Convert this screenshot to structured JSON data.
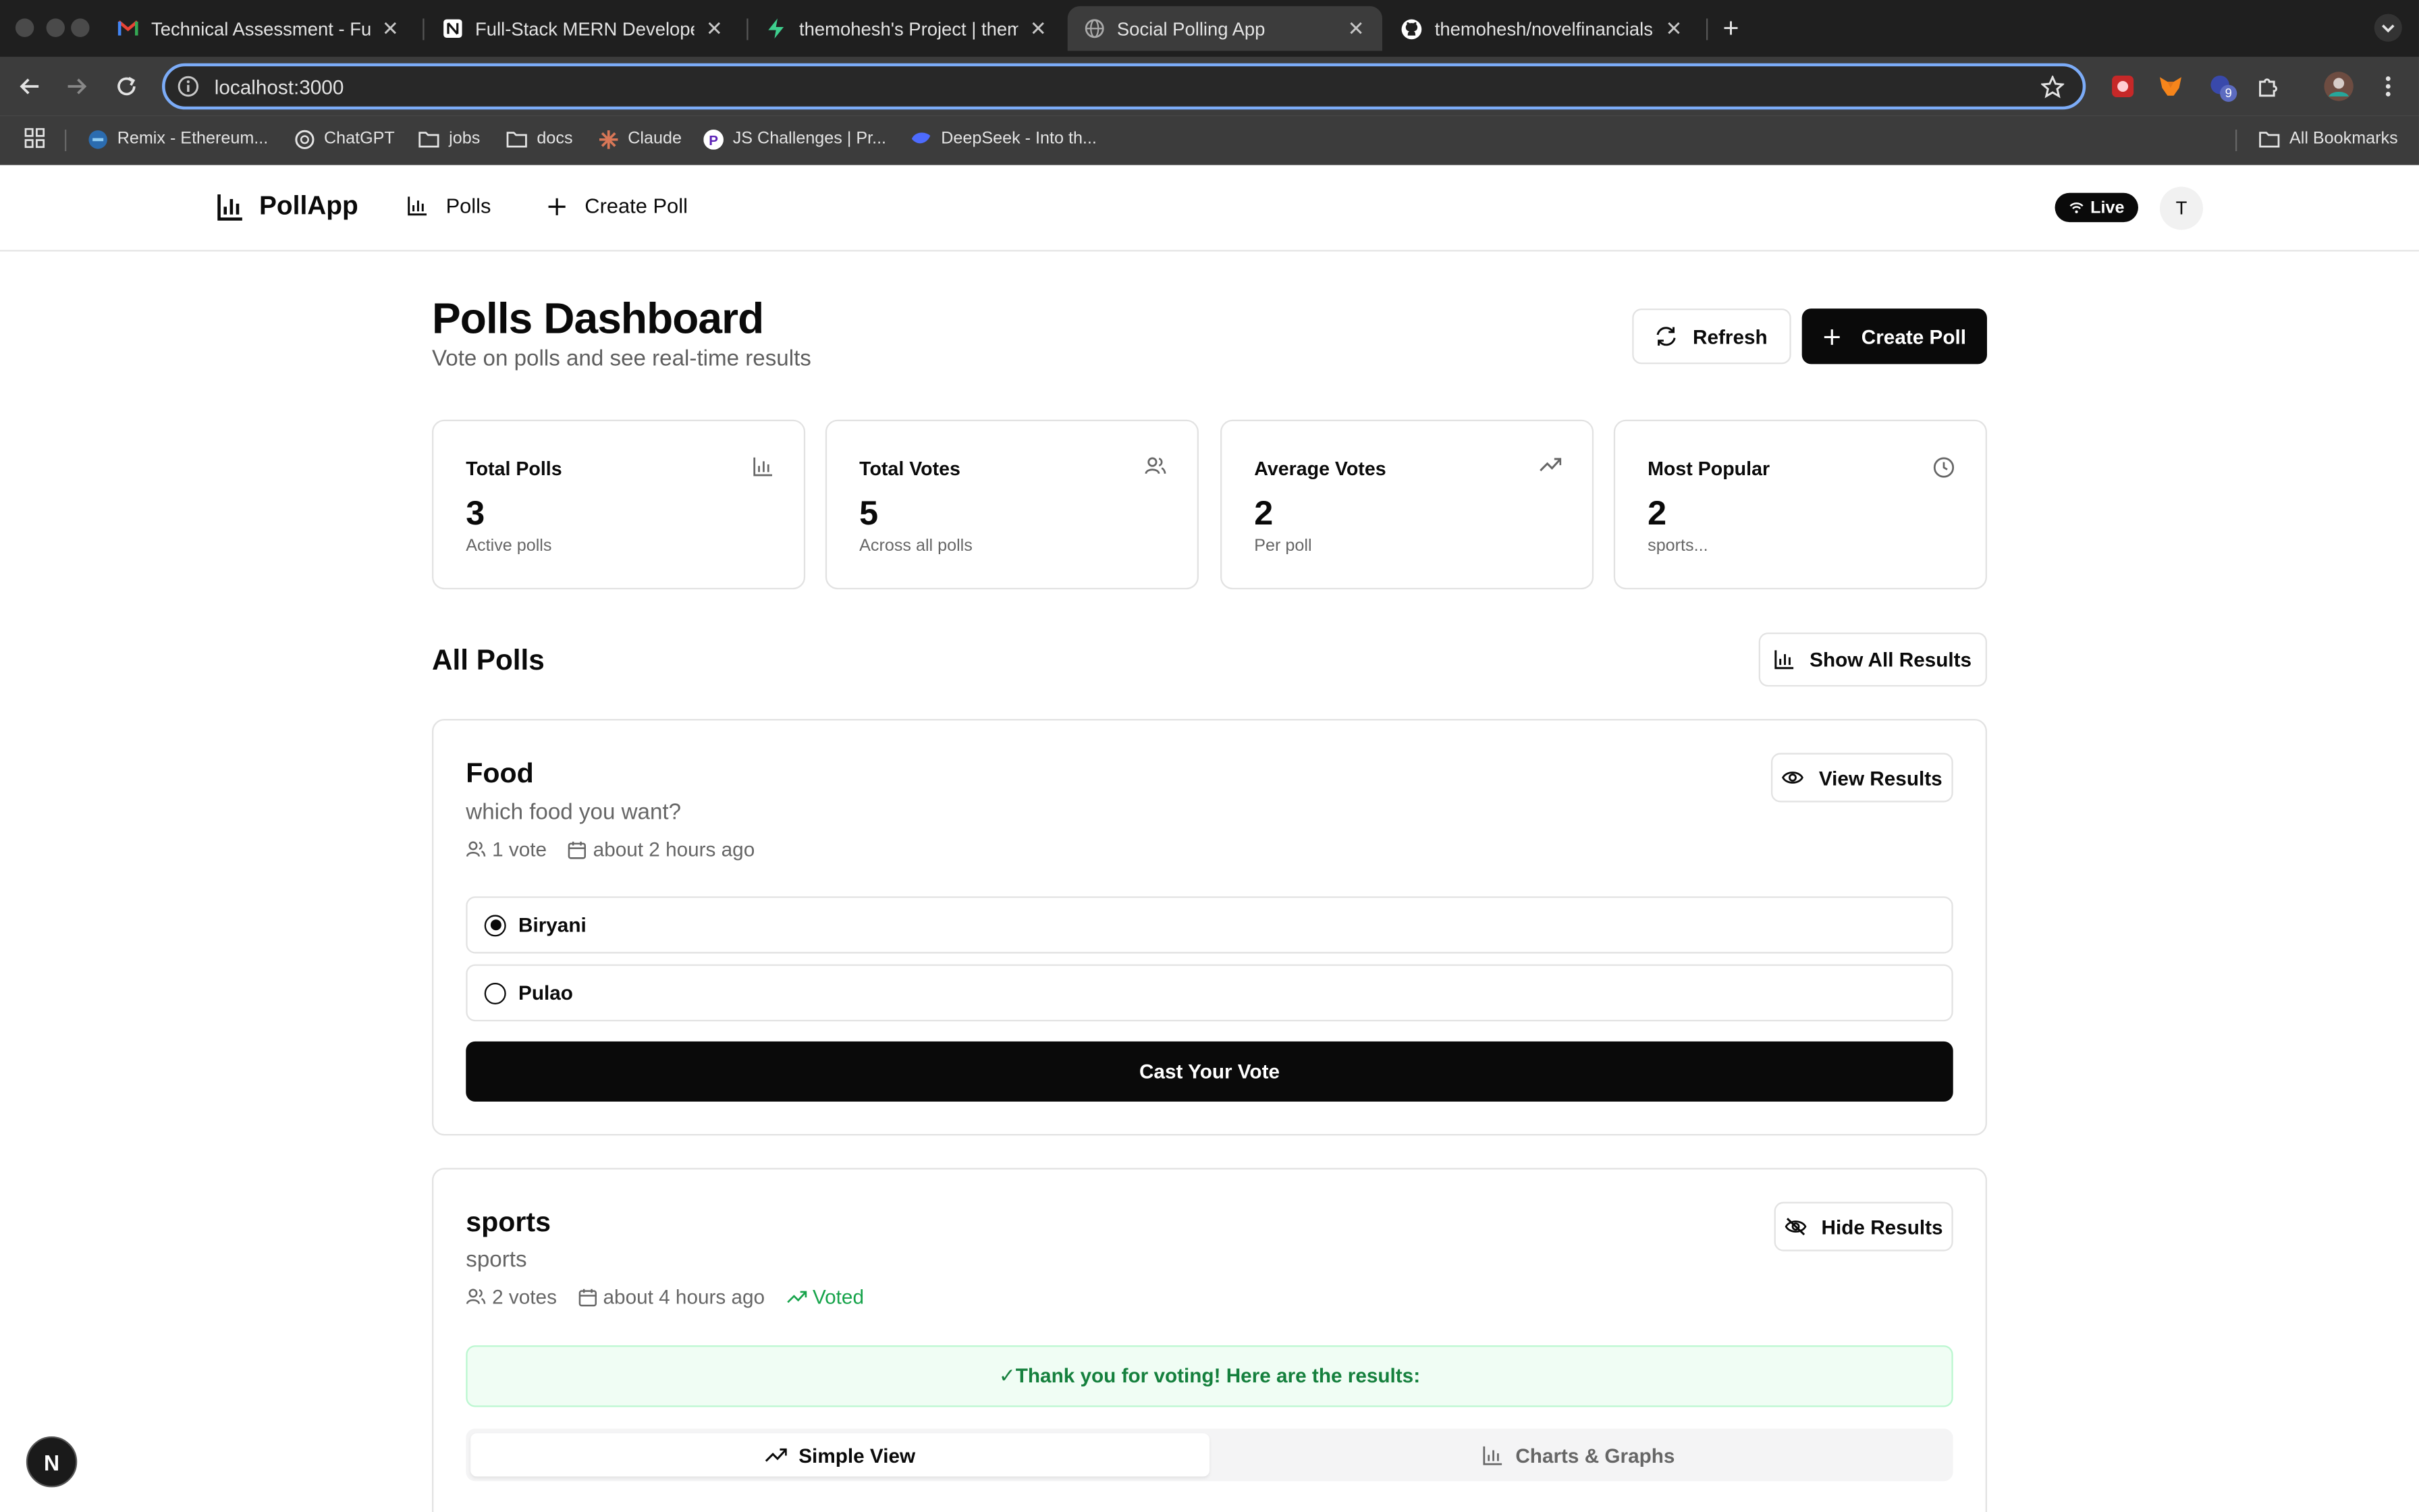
{
  "browser": {
    "tabs": [
      {
        "title": "Technical Assessment - Fullst",
        "icon": "gmail-icon"
      },
      {
        "title": "Full-Stack MERN Developer T",
        "icon": "notion-icon"
      },
      {
        "title": "themohesh's Project | themo",
        "icon": "supabase-icon"
      },
      {
        "title": "Social Polling App",
        "icon": "globe-icon"
      },
      {
        "title": "themohesh/novelfinancials-a",
        "icon": "github-icon"
      }
    ],
    "url": "localhost:3000",
    "extension_badge": "9",
    "bookmarks": [
      {
        "label": "Remix - Ethereum...",
        "icon": "remix-icon"
      },
      {
        "label": "ChatGPT",
        "icon": "chatgpt-icon"
      },
      {
        "label": "jobs",
        "icon": "folder-icon"
      },
      {
        "label": "docs",
        "icon": "folder-icon"
      },
      {
        "label": "Claude",
        "icon": "claude-icon"
      },
      {
        "label": "JS Challenges | Pr...",
        "icon": "p-icon"
      },
      {
        "label": "DeepSeek - Into th...",
        "icon": "deepseek-icon"
      }
    ],
    "all_bookmarks": "All Bookmarks"
  },
  "nav": {
    "brand": "PollApp",
    "polls": "Polls",
    "create_poll": "Create Poll",
    "live": "Live",
    "avatar": "T"
  },
  "header": {
    "title": "Polls Dashboard",
    "subtitle": "Vote on polls and see real-time results",
    "refresh": "Refresh",
    "create_poll": "Create Poll"
  },
  "stats": [
    {
      "label": "Total Polls",
      "value": "3",
      "note": "Active polls",
      "icon": "bar-chart-icon"
    },
    {
      "label": "Total Votes",
      "value": "5",
      "note": "Across all polls",
      "icon": "users-icon"
    },
    {
      "label": "Average Votes",
      "value": "2",
      "note": "Per poll",
      "icon": "trending-up-icon"
    },
    {
      "label": "Most Popular",
      "value": "2",
      "note": "sports...",
      "icon": "clock-icon"
    }
  ],
  "all_polls": {
    "title": "All Polls",
    "show_all": "Show All Results"
  },
  "polls": [
    {
      "title": "Food",
      "description": "which food you want?",
      "votes": "1 vote",
      "created": "about 2 hours ago",
      "action": "View Results",
      "options": [
        {
          "label": "Biryani",
          "selected": true
        },
        {
          "label": "Pulao",
          "selected": false
        }
      ],
      "cast": "Cast Your Vote"
    },
    {
      "title": "sports",
      "description": "sports",
      "votes": "2 votes",
      "created": "about 4 hours ago",
      "voted": "Voted",
      "action": "Hide Results",
      "thanks": "✓Thank you for voting! Here are the results:",
      "tabs": [
        "Simple View",
        "Charts & Graphs"
      ]
    }
  ],
  "fab": "N"
}
